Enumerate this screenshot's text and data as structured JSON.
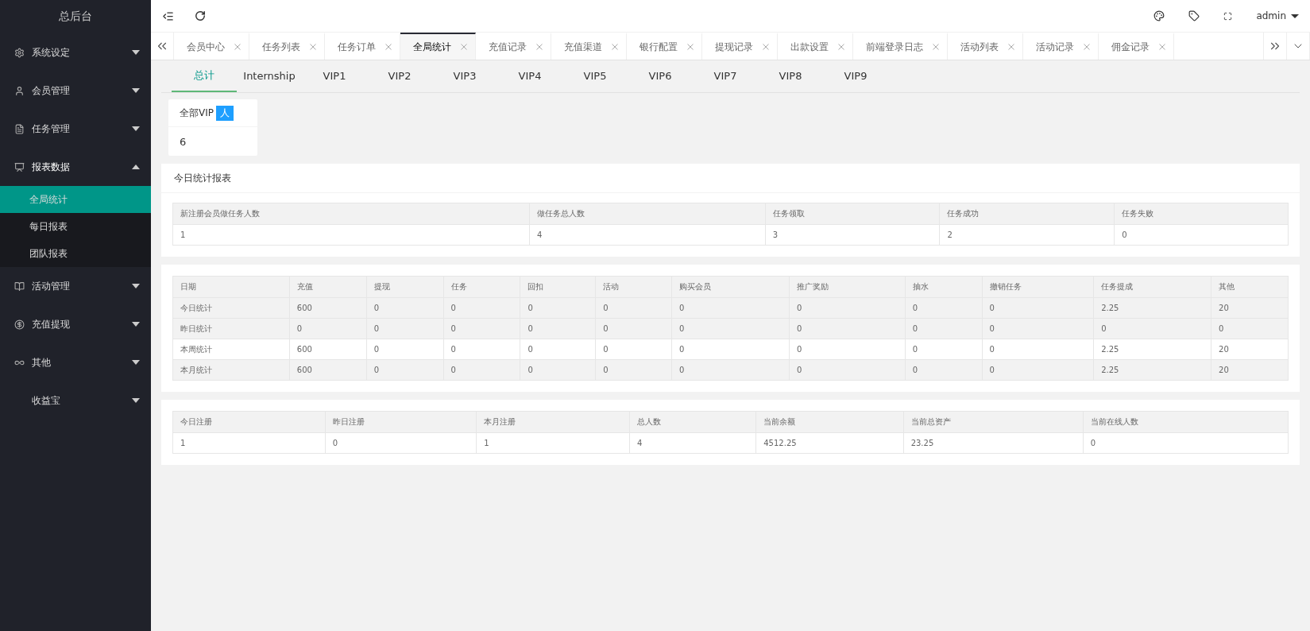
{
  "sidebar": {
    "title": "总后台",
    "menu": [
      {
        "label": "系统设定",
        "expanded": false
      },
      {
        "label": "会员管理",
        "expanded": false
      },
      {
        "label": "任务管理",
        "expanded": false
      },
      {
        "label": "报表数据",
        "expanded": true,
        "children": [
          {
            "label": "全局统计",
            "selected": true
          },
          {
            "label": "每日报表",
            "selected": false
          },
          {
            "label": "团队报表",
            "selected": false
          }
        ]
      },
      {
        "label": "活动管理",
        "expanded": false
      },
      {
        "label": "充值提现",
        "expanded": false
      },
      {
        "label": "其他",
        "expanded": false
      },
      {
        "label": "收益宝",
        "expanded": false
      }
    ]
  },
  "header": {
    "user": "admin"
  },
  "tabs": [
    {
      "label": "会员中心",
      "selected": false
    },
    {
      "label": "任务列表",
      "selected": false
    },
    {
      "label": "任务订单",
      "selected": false
    },
    {
      "label": "全局统计",
      "selected": true
    },
    {
      "label": "充值记录",
      "selected": false
    },
    {
      "label": "充值渠道",
      "selected": false
    },
    {
      "label": "银行配置",
      "selected": false
    },
    {
      "label": "提现记录",
      "selected": false
    },
    {
      "label": "出款设置",
      "selected": false
    },
    {
      "label": "前端登录日志",
      "selected": false
    },
    {
      "label": "活动列表",
      "selected": false
    },
    {
      "label": "活动记录",
      "selected": false
    },
    {
      "label": "佣金记录",
      "selected": false
    }
  ],
  "subtabs": [
    {
      "label": "总计",
      "selected": true
    },
    {
      "label": "Internship",
      "selected": false
    },
    {
      "label": "VIP1",
      "selected": false
    },
    {
      "label": "VIP2",
      "selected": false
    },
    {
      "label": "VIP3",
      "selected": false
    },
    {
      "label": "VIP4",
      "selected": false
    },
    {
      "label": "VIP5",
      "selected": false
    },
    {
      "label": "VIP6",
      "selected": false
    },
    {
      "label": "VIP7",
      "selected": false
    },
    {
      "label": "VIP8",
      "selected": false
    },
    {
      "label": "VIP9",
      "selected": false
    }
  ],
  "stat_card": {
    "title": "全部VIP",
    "badge": "人",
    "value": "6"
  },
  "today_report": {
    "title": "今日统计报表",
    "columns": [
      "新注册会员做任务人数",
      "做任务总人数",
      "任务领取",
      "任务成功",
      "任务失败"
    ],
    "rows": [
      {
        "cells": [
          "1",
          "4",
          "3",
          "2",
          "0"
        ],
        "shaded": false
      }
    ]
  },
  "finance_table": {
    "columns": [
      "日期",
      "充值",
      "提现",
      "任务",
      "回扣",
      "活动",
      "购买会员",
      "推广奖励",
      "抽水",
      "撤销任务",
      "任务提成",
      "其他"
    ],
    "rows": [
      {
        "cells": [
          "今日统计",
          "600",
          "0",
          "0",
          "0",
          "0",
          "0",
          "0",
          "0",
          "0",
          "2.25",
          "20"
        ],
        "shaded": true
      },
      {
        "cells": [
          "昨日统计",
          "0",
          "0",
          "0",
          "0",
          "0",
          "0",
          "0",
          "0",
          "0",
          "0",
          "0"
        ],
        "shaded": true
      },
      {
        "cells": [
          "本周统计",
          "600",
          "0",
          "0",
          "0",
          "0",
          "0",
          "0",
          "0",
          "0",
          "2.25",
          "20"
        ],
        "shaded": false
      },
      {
        "cells": [
          "本月统计",
          "600",
          "0",
          "0",
          "0",
          "0",
          "0",
          "0",
          "0",
          "0",
          "2.25",
          "20"
        ],
        "shaded": true
      }
    ]
  },
  "member_table": {
    "columns": [
      "今日注册",
      "昨日注册",
      "本月注册",
      "总人数",
      "当前余额",
      "当前总资产",
      "当前在线人数"
    ],
    "rows": [
      {
        "cells": [
          "1",
          "0",
          "1",
          "4",
          "4512.25",
          "23.25",
          "0"
        ],
        "shaded": false
      }
    ]
  }
}
